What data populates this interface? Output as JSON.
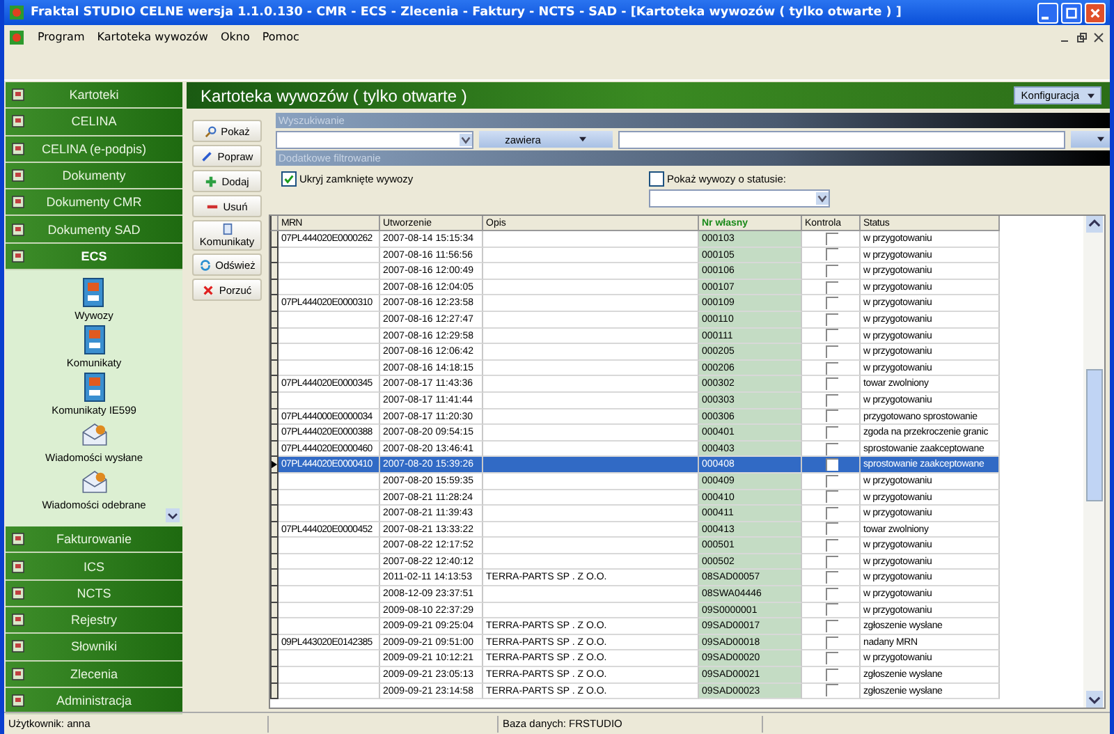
{
  "window": {
    "title": "Fraktal STUDIO CELNE  wersja 1.1.0.130 - CMR - ECS - Zlecenia - Faktury - NCTS - SAD - [Kartoteka wywozów ( tylko otwarte ) ]"
  },
  "menu": [
    "Program",
    "Kartoteka wywozów",
    "Okno",
    "Pomoc"
  ],
  "sidebar": {
    "sections": [
      {
        "label": "Kartoteki",
        "expanded": false
      },
      {
        "label": "CELINA",
        "expanded": false
      },
      {
        "label": "CELINA (e-podpis)",
        "expanded": false
      },
      {
        "label": "Dokumenty",
        "expanded": false
      },
      {
        "label": "Dokumenty CMR",
        "expanded": false
      },
      {
        "label": "Dokumenty SAD",
        "expanded": false
      },
      {
        "label": "ECS",
        "expanded": true,
        "items": [
          {
            "label": "Wywozy",
            "kind": "box"
          },
          {
            "label": "Komunikaty",
            "kind": "box"
          },
          {
            "label": "Komunikaty IE599",
            "kind": "box"
          },
          {
            "label": "Wiadomości wysłane",
            "kind": "mail"
          },
          {
            "label": "Wiadomości odebrane",
            "kind": "mail"
          }
        ]
      },
      {
        "label": "Fakturowanie",
        "expanded": false
      },
      {
        "label": "ICS",
        "expanded": false
      },
      {
        "label": "NCTS",
        "expanded": false
      },
      {
        "label": "Rejestry",
        "expanded": false
      },
      {
        "label": "Słowniki",
        "expanded": false
      },
      {
        "label": "Zlecenia",
        "expanded": false
      },
      {
        "label": "Administracja",
        "expanded": false
      }
    ]
  },
  "panel": {
    "title": "Kartoteka wywozów ( tylko otwarte )",
    "config_button": "Konfiguracja"
  },
  "actions": [
    {
      "label": "Pokaż",
      "kind": "view"
    },
    {
      "label": "Popraw",
      "kind": "edit"
    },
    {
      "label": "Dodaj",
      "kind": "add"
    },
    {
      "label": "Usuń",
      "kind": "remove"
    },
    {
      "label": "Komunikaty",
      "kind": "messages"
    },
    {
      "label": "Odśwież",
      "kind": "refresh"
    },
    {
      "label": "Porzuć",
      "kind": "cancel"
    }
  ],
  "search": {
    "section_title": "Wyszukiwanie",
    "operator": "zawiera"
  },
  "filter": {
    "section_title": "Dodatkowe filtrowanie",
    "hide_closed": {
      "label": "Ukryj zamknięte wywozy",
      "checked": true
    },
    "by_status": {
      "label": "Pokaż wywozy o statusie:",
      "checked": false
    }
  },
  "table": {
    "columns": [
      {
        "label": "MRN",
        "sorted": false
      },
      {
        "label": "Utworzenie",
        "sorted": false
      },
      {
        "label": "Opis",
        "sorted": false
      },
      {
        "label": "Nr własny",
        "sorted": true
      },
      {
        "label": "Kontrola",
        "sorted": false
      },
      {
        "label": "Status",
        "sorted": false
      }
    ],
    "rows": [
      {
        "mrn": "07PL444020E0000262",
        "created": "2007-08-14 15:15:34",
        "desc": "",
        "number": "000103",
        "control": false,
        "status": "w przygotowaniu",
        "selected": false
      },
      {
        "mrn": "",
        "created": "2007-08-16 11:56:56",
        "desc": "",
        "number": "000105",
        "control": false,
        "status": "w przygotowaniu",
        "selected": false
      },
      {
        "mrn": "",
        "created": "2007-08-16 12:00:49",
        "desc": "",
        "number": "000106",
        "control": false,
        "status": "w przygotowaniu",
        "selected": false
      },
      {
        "mrn": "",
        "created": "2007-08-16 12:04:05",
        "desc": "",
        "number": "000107",
        "control": false,
        "status": "w przygotowaniu",
        "selected": false
      },
      {
        "mrn": "07PL444020E0000310",
        "created": "2007-08-16 12:23:58",
        "desc": "",
        "number": "000109",
        "control": false,
        "status": "w przygotowaniu",
        "selected": false
      },
      {
        "mrn": "",
        "created": "2007-08-16 12:27:47",
        "desc": "",
        "number": "000110",
        "control": false,
        "status": "w przygotowaniu",
        "selected": false
      },
      {
        "mrn": "",
        "created": "2007-08-16 12:29:58",
        "desc": "",
        "number": "000111",
        "control": false,
        "status": "w przygotowaniu",
        "selected": false
      },
      {
        "mrn": "",
        "created": "2007-08-16 12:06:42",
        "desc": "",
        "number": "000205",
        "control": false,
        "status": "w przygotowaniu",
        "selected": false
      },
      {
        "mrn": "",
        "created": "2007-08-16 14:18:15",
        "desc": "",
        "number": "000206",
        "control": false,
        "status": "w przygotowaniu",
        "selected": false
      },
      {
        "mrn": "07PL444020E0000345",
        "created": "2007-08-17 11:43:36",
        "desc": "",
        "number": "000302",
        "control": false,
        "status": "towar zwolniony",
        "selected": false
      },
      {
        "mrn": "",
        "created": "2007-08-17 11:41:44",
        "desc": "",
        "number": "000303",
        "control": false,
        "status": "w przygotowaniu",
        "selected": false
      },
      {
        "mrn": "07PL444000E0000034",
        "created": "2007-08-17 11:20:30",
        "desc": "",
        "number": "000306",
        "control": false,
        "status": "przygotowano sprostowanie",
        "selected": false
      },
      {
        "mrn": "07PL444020E0000388",
        "created": "2007-08-20 09:54:15",
        "desc": "",
        "number": "000401",
        "control": false,
        "status": "zgoda na przekroczenie granic",
        "selected": false
      },
      {
        "mrn": "07PL444020E0000460",
        "created": "2007-08-20 13:46:41",
        "desc": "",
        "number": "000403",
        "control": false,
        "status": "sprostowanie zaakceptowane",
        "selected": false
      },
      {
        "mrn": "07PL444020E0000410",
        "created": "2007-08-20 15:39:26",
        "desc": "",
        "number": "000408",
        "control": false,
        "status": "sprostowanie zaakceptowane",
        "selected": true
      },
      {
        "mrn": "",
        "created": "2007-08-20 15:59:35",
        "desc": "",
        "number": "000409",
        "control": false,
        "status": "w przygotowaniu",
        "selected": false
      },
      {
        "mrn": "",
        "created": "2007-08-21 11:28:24",
        "desc": "",
        "number": "000410",
        "control": false,
        "status": "w przygotowaniu",
        "selected": false
      },
      {
        "mrn": "",
        "created": "2007-08-21 11:39:43",
        "desc": "",
        "number": "000411",
        "control": false,
        "status": "w przygotowaniu",
        "selected": false
      },
      {
        "mrn": "07PL444020E0000452",
        "created": "2007-08-21 13:33:22",
        "desc": "",
        "number": "000413",
        "control": false,
        "status": "towar zwolniony",
        "selected": false
      },
      {
        "mrn": "",
        "created": "2007-08-22 12:17:52",
        "desc": "",
        "number": "000501",
        "control": false,
        "status": "w przygotowaniu",
        "selected": false
      },
      {
        "mrn": "",
        "created": "2007-08-22 12:40:12",
        "desc": "",
        "number": "000502",
        "control": false,
        "status": "w przygotowaniu",
        "selected": false
      },
      {
        "mrn": "",
        "created": "2011-02-11 14:13:53",
        "desc": "TERRA-PARTS SP . Z O.O.",
        "number": "08SAD00057",
        "control": false,
        "status": "w przygotowaniu",
        "selected": false
      },
      {
        "mrn": "",
        "created": "2008-12-09 23:37:51",
        "desc": "",
        "number": "08SWA04446",
        "control": false,
        "status": "w przygotowaniu",
        "selected": false
      },
      {
        "mrn": "",
        "created": "2009-08-10 22:37:29",
        "desc": "",
        "number": "09S0000001",
        "control": false,
        "status": "w przygotowaniu",
        "selected": false
      },
      {
        "mrn": "",
        "created": "2009-09-21 09:25:04",
        "desc": "TERRA-PARTS SP . Z O.O.",
        "number": "09SAD00017",
        "control": false,
        "status": "zgłoszenie wysłane",
        "selected": false
      },
      {
        "mrn": "09PL443020E0142385",
        "created": "2009-09-21 09:51:00",
        "desc": "TERRA-PARTS SP . Z O.O.",
        "number": "09SAD00018",
        "control": false,
        "status": "nadany MRN",
        "selected": false
      },
      {
        "mrn": "",
        "created": "2009-09-21 10:12:21",
        "desc": "TERRA-PARTS SP . Z O.O.",
        "number": "09SAD00020",
        "control": false,
        "status": "w przygotowaniu",
        "selected": false
      },
      {
        "mrn": "",
        "created": "2009-09-21 23:05:13",
        "desc": "TERRA-PARTS SP . Z O.O.",
        "number": "09SAD00021",
        "control": false,
        "status": "zgłoszenie wysłane",
        "selected": false
      },
      {
        "mrn": "",
        "created": "2009-09-21 23:14:58",
        "desc": "TERRA-PARTS SP . Z O.O.",
        "number": "09SAD00023",
        "control": false,
        "status": "zgłoszenie wysłane",
        "selected": false
      }
    ]
  },
  "status_bar": {
    "user": "Użytkownik: anna",
    "database": "Baza danych: FRSTUDIO"
  }
}
